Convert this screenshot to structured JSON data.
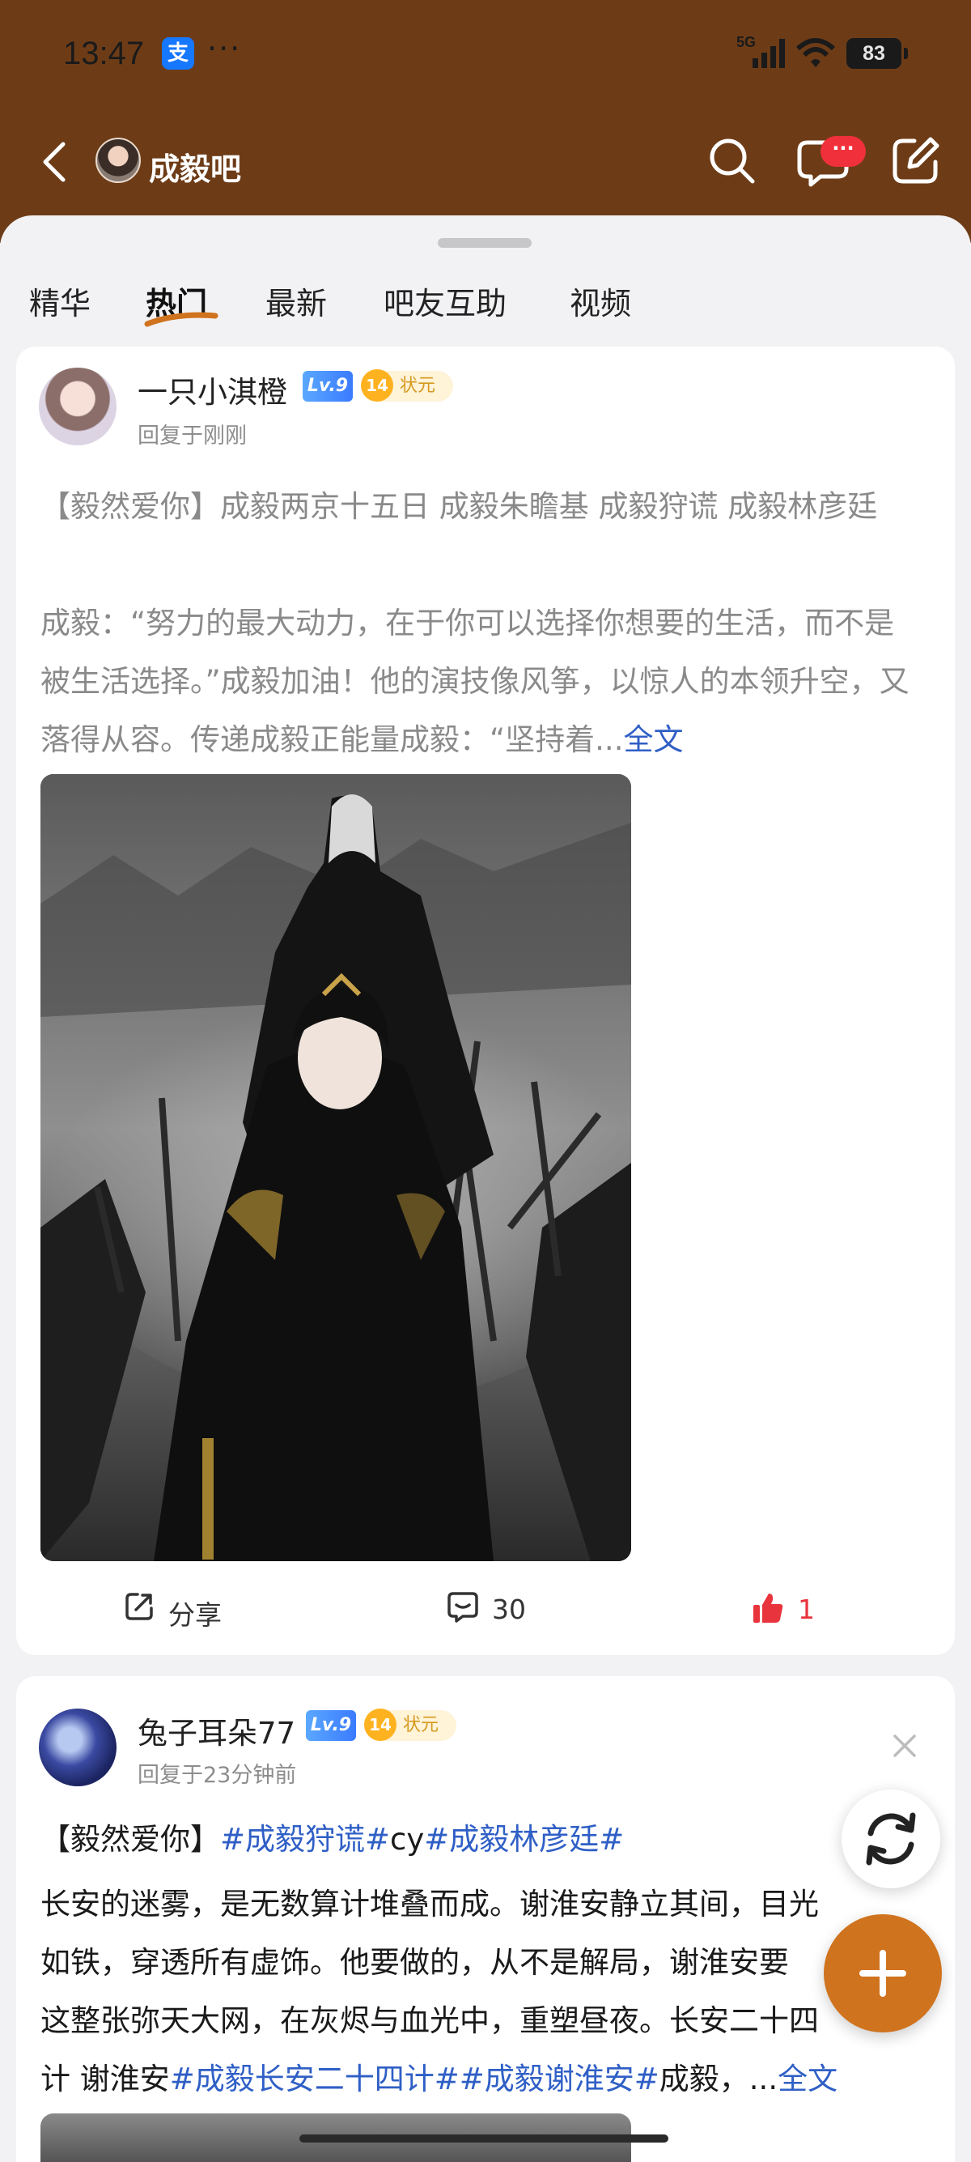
{
  "status_bar": {
    "time": "13:47",
    "app_badge": "支",
    "more": "···",
    "network": "5G",
    "battery": "83"
  },
  "header": {
    "forum_name": "成毅吧",
    "message_badge": "···"
  },
  "tabs": [
    {
      "label": "精华",
      "active": false
    },
    {
      "label": "热门",
      "active": true
    },
    {
      "label": "最新",
      "active": false
    },
    {
      "label": "吧友互助",
      "active": false
    },
    {
      "label": "视频",
      "active": false
    }
  ],
  "posts": [
    {
      "username": "一只小淇橙",
      "level": "Lv.9",
      "rank_num": "14",
      "rank_title": "状元",
      "reply_time": "回复于刚刚",
      "title": "【毅然爱你】成毅两京十五日 成毅朱瞻基 成毅狩谎 成毅林彦廷",
      "body": "成毅：“努力的最大动力，在于你可以选择你想要的生活，而不是被生活选择。”成毅加油！他的演技像风筝，以惊人的本领升空，又落得从容。传递成毅正能量成毅：“坚持着...",
      "full_link": "全文",
      "share_label": "分享",
      "comment_count": "30",
      "like_count": "1"
    },
    {
      "username": "兔子耳朵77",
      "level": "Lv.9",
      "rank_num": "14",
      "rank_title": "状元",
      "reply_time": "回复于23分钟前",
      "title_prefix": "【毅然爱你】",
      "title_tag1": "#成毅狩谎#",
      "title_mid": "cy",
      "title_tag2": "#成毅林彦廷#",
      "body_line1": "长安的迷雾，是无数算计堆叠而成。谢淮安静立其间，目光",
      "body_line2": "如铁，穿透所有虚饰。他要做的，从不是解局，谢淮安要",
      "body_line3": "这整张弥天大网，在灰烬与血光中，重塑昼夜。长安二十四",
      "body_line4_prefix": "计 谢淮安",
      "body_line4_tag1": "#成毅长安二十四计#",
      "body_line4_tag2": "#成毅谢淮安#",
      "body_line4_suffix": "成毅，...",
      "full_link": "全文"
    }
  ],
  "colors": {
    "header_bg": "#6d3c17",
    "accent": "#d0731e",
    "link": "#2f5fc6",
    "like": "#e8343c"
  }
}
